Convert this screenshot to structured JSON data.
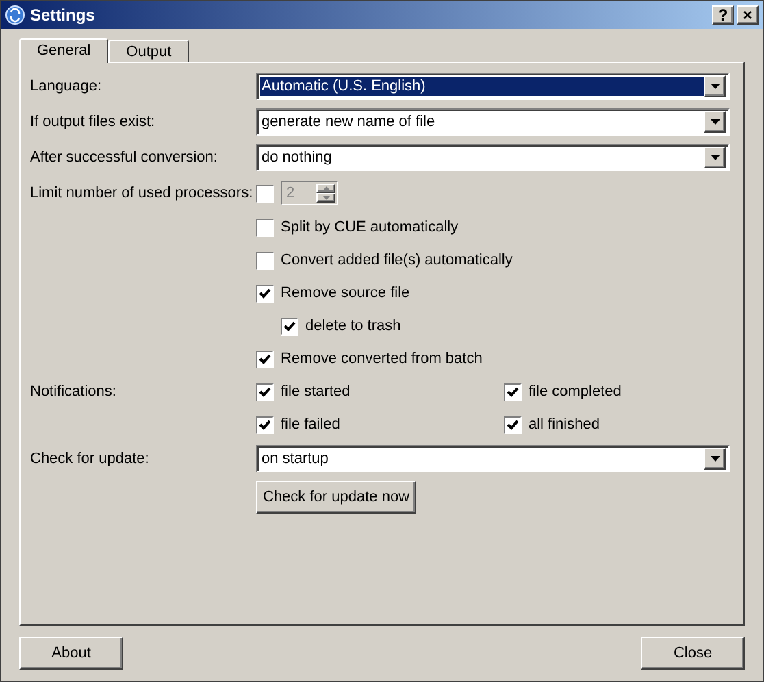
{
  "window": {
    "title": "Settings",
    "title_buttons": [
      "?",
      "×"
    ]
  },
  "tabs": [
    {
      "label": "General",
      "selected": true
    },
    {
      "label": "Output",
      "selected": false
    }
  ],
  "combos": [
    {
      "label": "Language:",
      "value": "Automatic (U.S. English)",
      "focused": true
    },
    {
      "label": "If output files exist:",
      "value": "generate new name of file",
      "focused": false
    },
    {
      "label": "After successful conversion:",
      "value": "do nothing",
      "focused": false
    }
  ],
  "processors": {
    "label": "Limit number of used processors:",
    "checked": false,
    "value": "2",
    "disabled": true
  },
  "options": [
    {
      "label": "Split by CUE automatically",
      "checked": false
    },
    {
      "label": "Convert added file(s) automatically",
      "checked": false
    },
    {
      "label": "Remove source file",
      "checked": true,
      "children": [
        {
          "label": "delete to trash",
          "checked": true
        }
      ]
    },
    {
      "label": "Remove converted from batch",
      "checked": true
    }
  ],
  "notifications": {
    "label": "Notifications:",
    "items": [
      {
        "label": "file started",
        "checked": true
      },
      {
        "label": "file completed",
        "checked": true
      },
      {
        "label": "file failed",
        "checked": true
      },
      {
        "label": "all finished",
        "checked": true
      }
    ]
  },
  "update": {
    "label": "Check for update:",
    "value": "on startup",
    "button": "Check for update now"
  },
  "footer_buttons": [
    "About",
    "Close"
  ]
}
